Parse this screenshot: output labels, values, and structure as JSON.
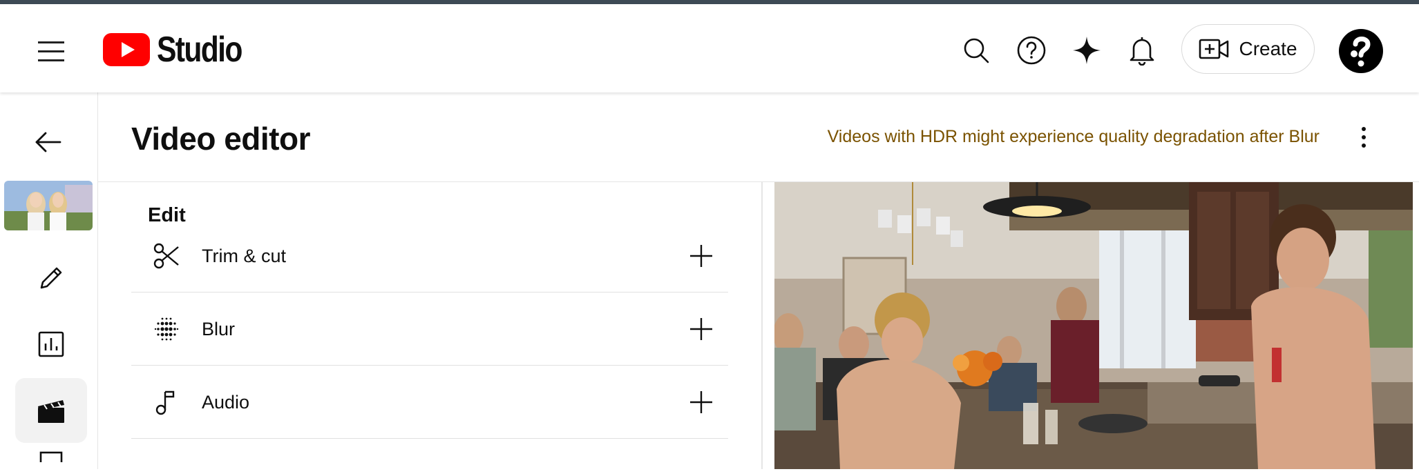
{
  "header": {
    "app_name": "Studio",
    "create_label": "Create",
    "brand_color": "#ff0000",
    "icons": [
      "menu-icon",
      "search-icon",
      "help-icon",
      "sparkle-icon",
      "bell-icon",
      "add-video-icon",
      "avatar"
    ]
  },
  "sidebar": {
    "icons": [
      "back-arrow-icon",
      "video-thumbnail",
      "pencil-icon",
      "analytics-icon",
      "clapperboard-icon"
    ],
    "active": "clapperboard-icon"
  },
  "page": {
    "title": "Video editor",
    "warning": "Videos with HDR might experience quality degradation after Blur",
    "warning_color": "#7a5200"
  },
  "edit_panel": {
    "heading": "Edit",
    "tools": [
      {
        "label": "Trim & cut",
        "icon": "scissors-icon"
      },
      {
        "label": "Blur",
        "icon": "blur-dots-icon"
      },
      {
        "label": "Audio",
        "icon": "music-note-icon"
      }
    ]
  }
}
